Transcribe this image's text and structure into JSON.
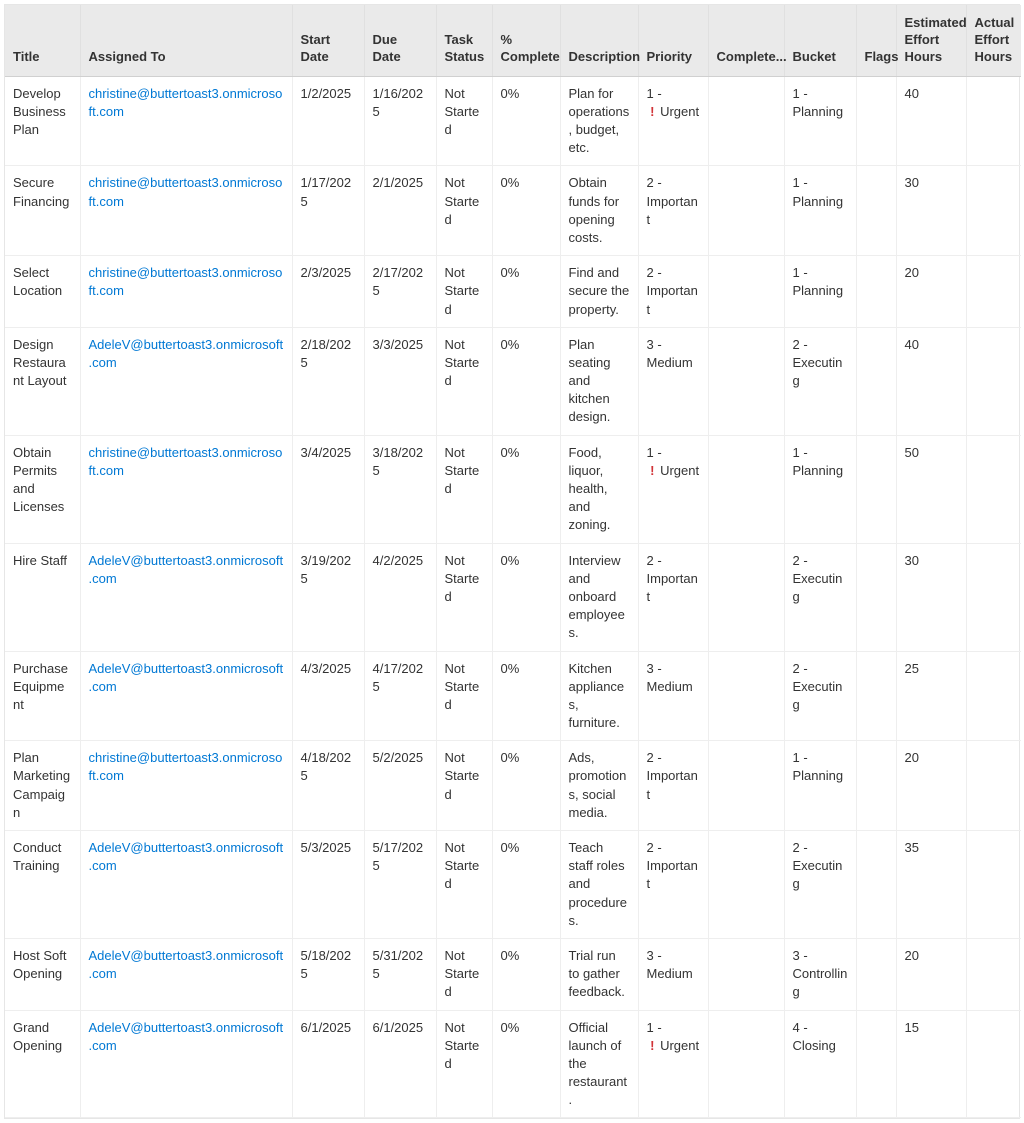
{
  "columns": [
    {
      "key": "title",
      "label": "Title"
    },
    {
      "key": "assigned_to",
      "label": "Assigned To"
    },
    {
      "key": "start_date",
      "label": "Start Date"
    },
    {
      "key": "due_date",
      "label": "Due Date"
    },
    {
      "key": "task_status",
      "label": "Task Status"
    },
    {
      "key": "percent_complete",
      "label": "% Complete"
    },
    {
      "key": "description",
      "label": "Description"
    },
    {
      "key": "priority",
      "label": "Priority"
    },
    {
      "key": "completed",
      "label": "Complete..."
    },
    {
      "key": "bucket",
      "label": "Bucket"
    },
    {
      "key": "flags",
      "label": "Flags"
    },
    {
      "key": "est_effort",
      "label": "Estimated Effort Hours"
    },
    {
      "key": "actual_effort",
      "label": "Actual Effort Hours"
    }
  ],
  "rows": [
    {
      "title": "Develop Business Plan",
      "assigned_to": "christine@buttertoast3.onmicrosoft.com",
      "start_date": "1/2/2025",
      "due_date": "1/16/2025",
      "task_status": "Not Started",
      "percent_complete": "0%",
      "description": "Plan for operations, budget, etc.",
      "priority_level": "1",
      "priority_label": "Urgent",
      "priority_urgent": true,
      "completed": "",
      "bucket": "1 - Planning",
      "flags": "",
      "est_effort": "40",
      "actual_effort": ""
    },
    {
      "title": "Secure Financing",
      "assigned_to": "christine@buttertoast3.onmicrosoft.com",
      "start_date": "1/17/2025",
      "due_date": "2/1/2025",
      "task_status": "Not Started",
      "percent_complete": "0%",
      "description": "Obtain funds for opening costs.",
      "priority_level": "2",
      "priority_label": "Important",
      "priority_urgent": false,
      "completed": "",
      "bucket": "1 - Planning",
      "flags": "",
      "est_effort": "30",
      "actual_effort": ""
    },
    {
      "title": "Select Location",
      "assigned_to": "christine@buttertoast3.onmicrosoft.com",
      "start_date": "2/3/2025",
      "due_date": "2/17/2025",
      "task_status": "Not Started",
      "percent_complete": "0%",
      "description": "Find and secure the property.",
      "priority_level": "2",
      "priority_label": "Important",
      "priority_urgent": false,
      "completed": "",
      "bucket": "1 - Planning",
      "flags": "",
      "est_effort": "20",
      "actual_effort": ""
    },
    {
      "title": "Design Restaurant Layout",
      "assigned_to": "AdeleV@buttertoast3.onmicrosoft.com",
      "start_date": "2/18/2025",
      "due_date": "3/3/2025",
      "task_status": "Not Started",
      "percent_complete": "0%",
      "description": "Plan seating and kitchen design.",
      "priority_level": "3",
      "priority_label": "Medium",
      "priority_urgent": false,
      "completed": "",
      "bucket": "2 - Executing",
      "flags": "",
      "est_effort": "40",
      "actual_effort": ""
    },
    {
      "title": "Obtain Permits and Licenses",
      "assigned_to": "christine@buttertoast3.onmicrosoft.com",
      "start_date": "3/4/2025",
      "due_date": "3/18/2025",
      "task_status": "Not Started",
      "percent_complete": "0%",
      "description": "Food, liquor, health, and zoning.",
      "priority_level": "1",
      "priority_label": "Urgent",
      "priority_urgent": true,
      "completed": "",
      "bucket": "1 - Planning",
      "flags": "",
      "est_effort": "50",
      "actual_effort": ""
    },
    {
      "title": "Hire Staff",
      "assigned_to": "AdeleV@buttertoast3.onmicrosoft.com",
      "start_date": "3/19/2025",
      "due_date": "4/2/2025",
      "task_status": "Not Started",
      "percent_complete": "0%",
      "description": "Interview and onboard employees.",
      "priority_level": "2",
      "priority_label": "Important",
      "priority_urgent": false,
      "completed": "",
      "bucket": "2 - Executing",
      "flags": "",
      "est_effort": "30",
      "actual_effort": ""
    },
    {
      "title": "Purchase Equipment",
      "assigned_to": "AdeleV@buttertoast3.onmicrosoft.com",
      "start_date": "4/3/2025",
      "due_date": "4/17/2025",
      "task_status": "Not Started",
      "percent_complete": "0%",
      "description": "Kitchen appliances, furniture.",
      "priority_level": "3",
      "priority_label": "Medium",
      "priority_urgent": false,
      "completed": "",
      "bucket": "2 - Executing",
      "flags": "",
      "est_effort": "25",
      "actual_effort": ""
    },
    {
      "title": "Plan Marketing Campaign",
      "assigned_to": "christine@buttertoast3.onmicrosoft.com",
      "start_date": "4/18/2025",
      "due_date": "5/2/2025",
      "task_status": "Not Started",
      "percent_complete": "0%",
      "description": "Ads, promotions, social media.",
      "priority_level": "2",
      "priority_label": "Important",
      "priority_urgent": false,
      "completed": "",
      "bucket": "1 - Planning",
      "flags": "",
      "est_effort": "20",
      "actual_effort": ""
    },
    {
      "title": "Conduct Training",
      "assigned_to": "AdeleV@buttertoast3.onmicrosoft.com",
      "start_date": "5/3/2025",
      "due_date": "5/17/2025",
      "task_status": "Not Started",
      "percent_complete": "0%",
      "description": "Teach staff roles and procedures.",
      "priority_level": "2",
      "priority_label": "Important",
      "priority_urgent": false,
      "completed": "",
      "bucket": "2 - Executing",
      "flags": "",
      "est_effort": "35",
      "actual_effort": ""
    },
    {
      "title": "Host Soft Opening",
      "assigned_to": "AdeleV@buttertoast3.onmicrosoft.com",
      "start_date": "5/18/2025",
      "due_date": "5/31/2025",
      "task_status": "Not Started",
      "percent_complete": "0%",
      "description": "Trial run to gather feedback.",
      "priority_level": "3",
      "priority_label": "Medium",
      "priority_urgent": false,
      "completed": "",
      "bucket": "3 - Controlling",
      "flags": "",
      "est_effort": "20",
      "actual_effort": ""
    },
    {
      "title": "Grand Opening",
      "assigned_to": "AdeleV@buttertoast3.onmicrosoft.com",
      "start_date": "6/1/2025",
      "due_date": "6/1/2025",
      "task_status": "Not Started",
      "percent_complete": "0%",
      "description": "Official launch of the restaurant.",
      "priority_level": "1",
      "priority_label": "Urgent",
      "priority_urgent": true,
      "completed": "",
      "bucket": "4 - Closing",
      "flags": "",
      "est_effort": "15",
      "actual_effort": ""
    }
  ]
}
